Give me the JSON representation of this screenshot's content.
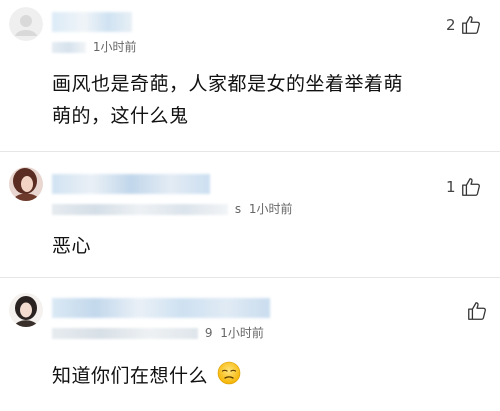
{
  "comments": [
    {
      "time": "小时前",
      "time_prefix": "1",
      "text_lines": [
        "画风也是奇葩，人家都是女的坐着举着萌",
        "萌的，这什么鬼"
      ],
      "likes": "2"
    },
    {
      "time": "1小时前",
      "meta_tail": "s",
      "text_lines": [
        "恶心"
      ],
      "likes": "1"
    },
    {
      "time": "1小时前",
      "meta_tail": "9",
      "text_lines": [
        "知道你们在想什么"
      ],
      "likes": ""
    }
  ],
  "colors": {
    "blur_a": "#cfe3f3",
    "blur_b": "#e9eef3",
    "blur_c": "#b9d3ea",
    "divider": "#e6e6e6",
    "icon": "#333333"
  },
  "icons": {
    "like": "thumbs-up-icon",
    "emoji": "unamused-face-emoji"
  }
}
